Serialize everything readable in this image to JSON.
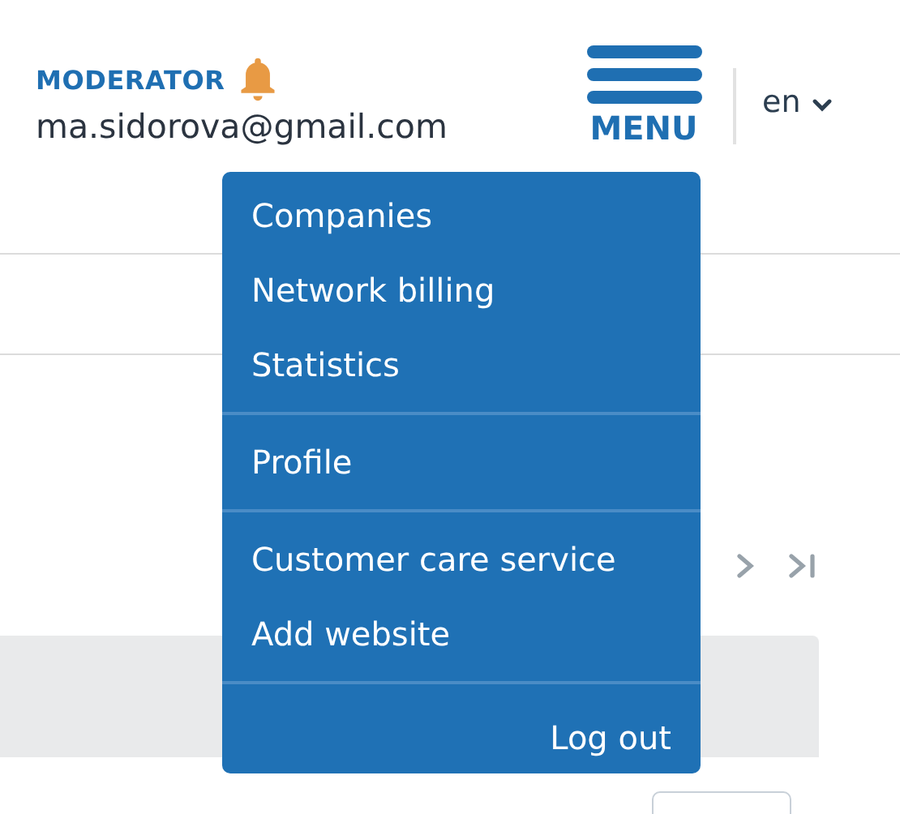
{
  "user": {
    "role": "MODERATOR",
    "email": "ma.sidorova@gmail.com",
    "notifications": true
  },
  "menu_button": {
    "label": "MENU"
  },
  "language": {
    "value": "en"
  },
  "menu": [
    {
      "kind": "nav",
      "items": [
        "Companies",
        "Network billing",
        "Statistics"
      ]
    },
    {
      "kind": "nav",
      "items": [
        "Profile"
      ]
    },
    {
      "kind": "nav",
      "items": [
        "Customer care service",
        "Add website"
      ]
    },
    {
      "kind": "action",
      "items": [
        "Log out"
      ]
    }
  ]
}
